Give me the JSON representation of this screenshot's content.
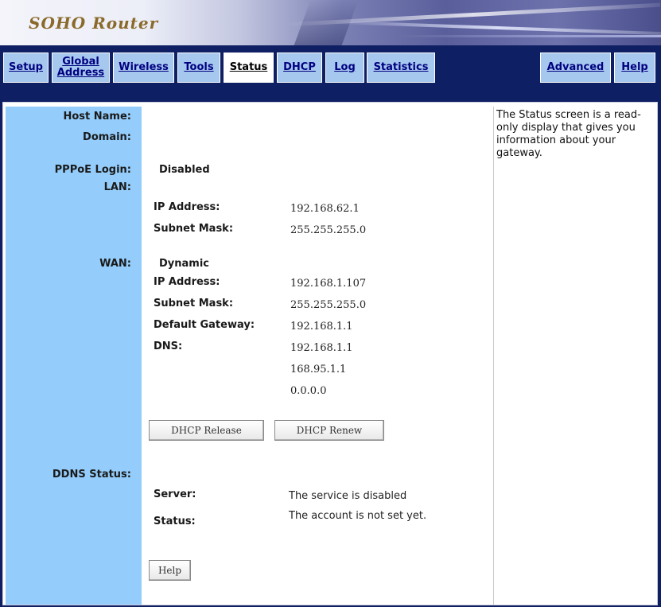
{
  "banner": {
    "brand": "SOHO Router"
  },
  "nav": {
    "setup": "Setup",
    "global_line1": "Global",
    "global_line2": "Address",
    "wireless": "Wireless",
    "tools": "Tools",
    "status": "Status",
    "dhcp": "DHCP",
    "log": "Log",
    "statistics": "Statistics",
    "advanced": "Advanced",
    "help": "Help"
  },
  "labels": {
    "host_name": "Host Name:",
    "domain": "Domain:",
    "pppoe_login": "PPPoE Login:",
    "lan": "LAN:",
    "wan": "WAN:",
    "ddns_status": "DDNS Status:"
  },
  "pppoe": {
    "value": "Disabled"
  },
  "lan": {
    "ip_label": "IP Address:",
    "ip_value": "192.168.62.1",
    "mask_label": "Subnet Mask:",
    "mask_value": "255.255.255.0"
  },
  "wan": {
    "mode": "Dynamic",
    "ip_label": "IP Address:",
    "ip_value": "192.168.1.107",
    "mask_label": "Subnet Mask:",
    "mask_value": "255.255.255.0",
    "gateway_label": "Default Gateway:",
    "gateway_value": "192.168.1.1",
    "dns_label": "DNS:",
    "dns1": "192.168.1.1",
    "dns2": "168.95.1.1",
    "dns3": "0.0.0.0"
  },
  "buttons": {
    "dhcp_release": "DHCP Release",
    "dhcp_renew": "DHCP Renew",
    "help": "Help"
  },
  "ddns": {
    "server_label": "Server:",
    "server_value": "The service is disabled",
    "status_label": "Status:",
    "status_value": "The account is not set yet."
  },
  "help_panel": {
    "text": "The Status screen is a read-only display that gives you information about your gateway."
  }
}
